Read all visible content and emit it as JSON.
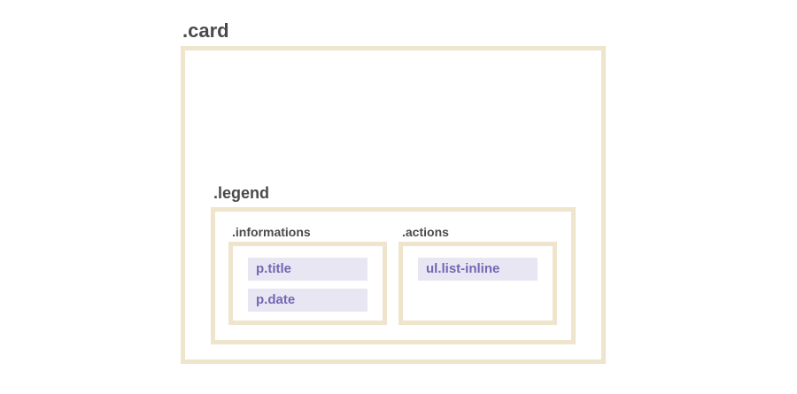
{
  "card": {
    "label": ".card"
  },
  "legend": {
    "label": ".legend"
  },
  "informations": {
    "label": ".informations",
    "items": [
      "p.title",
      "p.date"
    ]
  },
  "actions": {
    "label": ".actions",
    "items": [
      "ul.list-inline"
    ]
  },
  "colors": {
    "border": "#efe4cc",
    "pill_background": "#e9e6f3",
    "pill_text": "#7168b3",
    "label_text": "#4a4a4a"
  }
}
